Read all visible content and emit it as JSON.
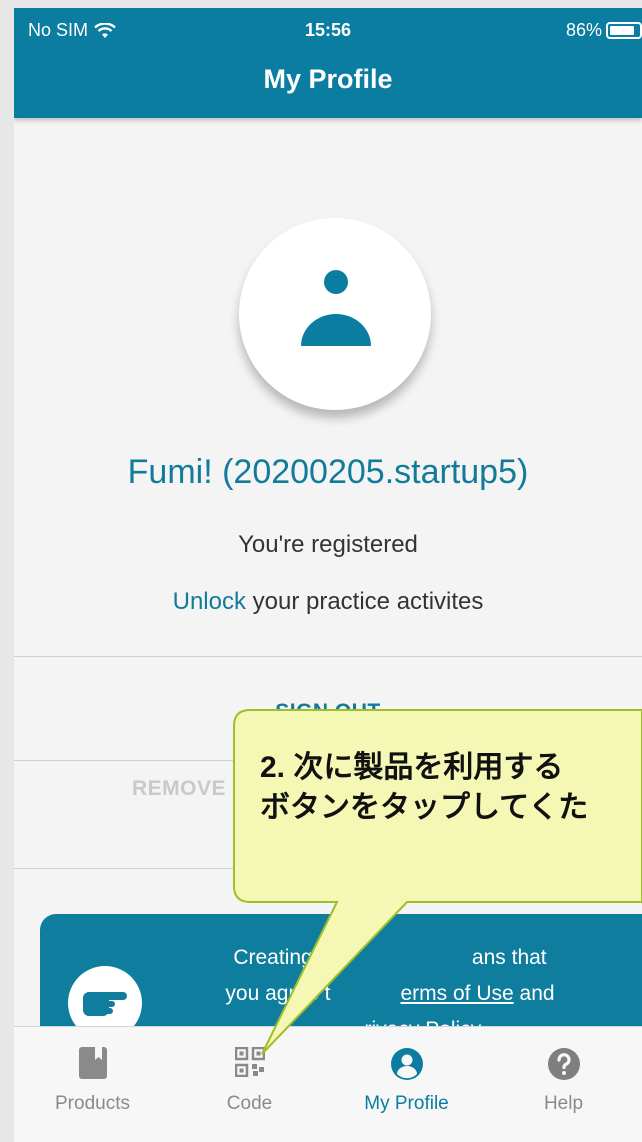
{
  "status_bar": {
    "carrier": "No SIM",
    "time": "15:56",
    "battery": "86%",
    "battery_level": 0.86
  },
  "header": {
    "title": "My Profile"
  },
  "profile": {
    "name": "Fumi! (20200205.startup5)",
    "registered_text": "You're registered",
    "unlock_link": "Unlock",
    "unlock_rest": " your practice activites"
  },
  "actions": {
    "sign_out": "SIGN OUT",
    "remove": "REMOVE"
  },
  "info_card": {
    "line1_a": "Creating an",
    "line1_b": "ans that",
    "line2_a": "you agree t",
    "terms_link": "erms of Use",
    "line2_and": " and",
    "privacy_link": "rivacy Policy."
  },
  "callout": {
    "line1": "2. 次に製品を利用する",
    "line2": "ボタンをタップしてくた"
  },
  "tabs": [
    {
      "label": "Products",
      "icon": "book-icon"
    },
    {
      "label": "Code",
      "icon": "qr-code-icon"
    },
    {
      "label": "My Profile",
      "icon": "user-circle-icon",
      "active": true
    },
    {
      "label": "Help",
      "icon": "help-circle-icon"
    }
  ],
  "colors": {
    "brand": "#0b7da0",
    "link": "#137b9a",
    "callout_bg": "#f4f8b4"
  }
}
